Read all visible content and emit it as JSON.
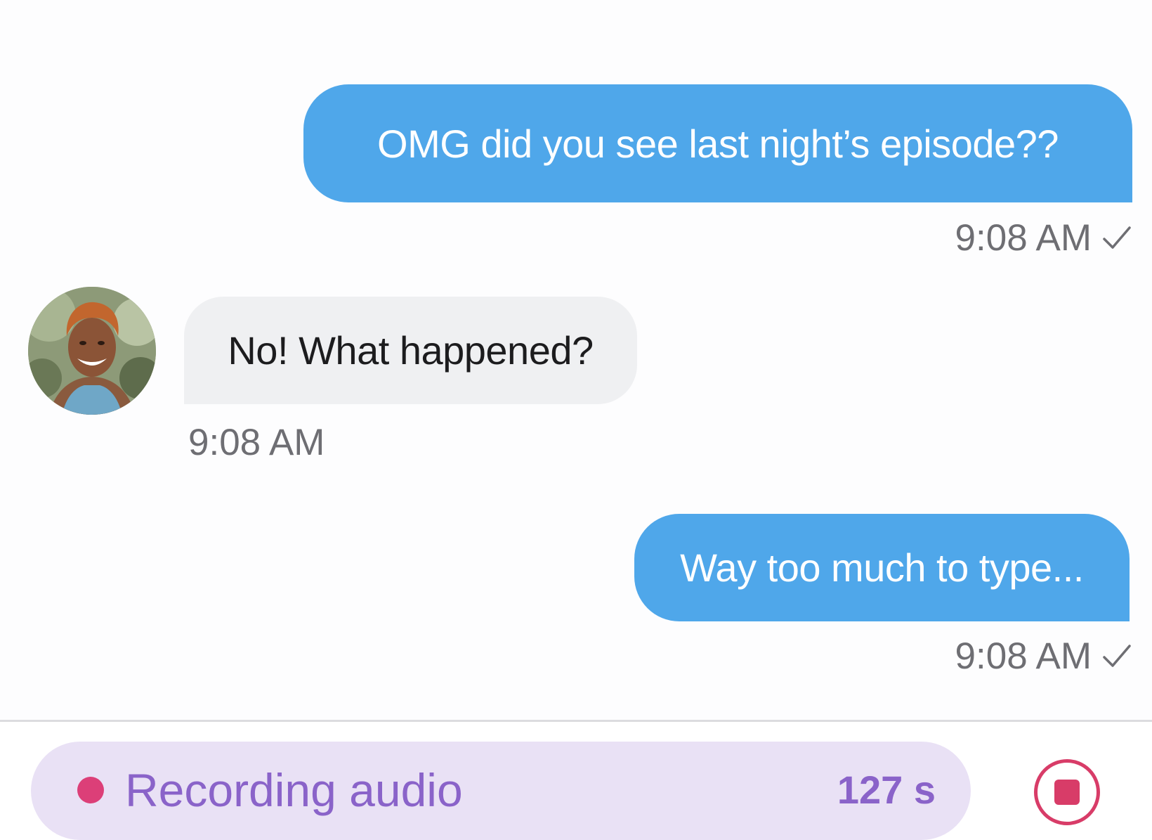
{
  "messages": [
    {
      "direction": "outgoing",
      "text": "OMG did you see last night’s episode??",
      "time": "9:08 AM",
      "status_icon": "check-icon"
    },
    {
      "direction": "incoming",
      "text": "No! What happened?",
      "time": "9:08 AM",
      "avatar_icon": "contact-avatar"
    },
    {
      "direction": "outgoing",
      "text": "Way too much to type...",
      "time": "9:08 AM",
      "status_icon": "check-icon"
    }
  ],
  "composer": {
    "recording_label": "Recording audio",
    "recording_time": "127 s",
    "stop_icon": "stop-icon"
  },
  "colors": {
    "outgoing_bubble": "#4fa7ea",
    "incoming_bubble": "#eff0f2",
    "recording_pill": "#e9e1f5",
    "recording_text": "#8a63c9",
    "record_accent": "#d83c68"
  }
}
